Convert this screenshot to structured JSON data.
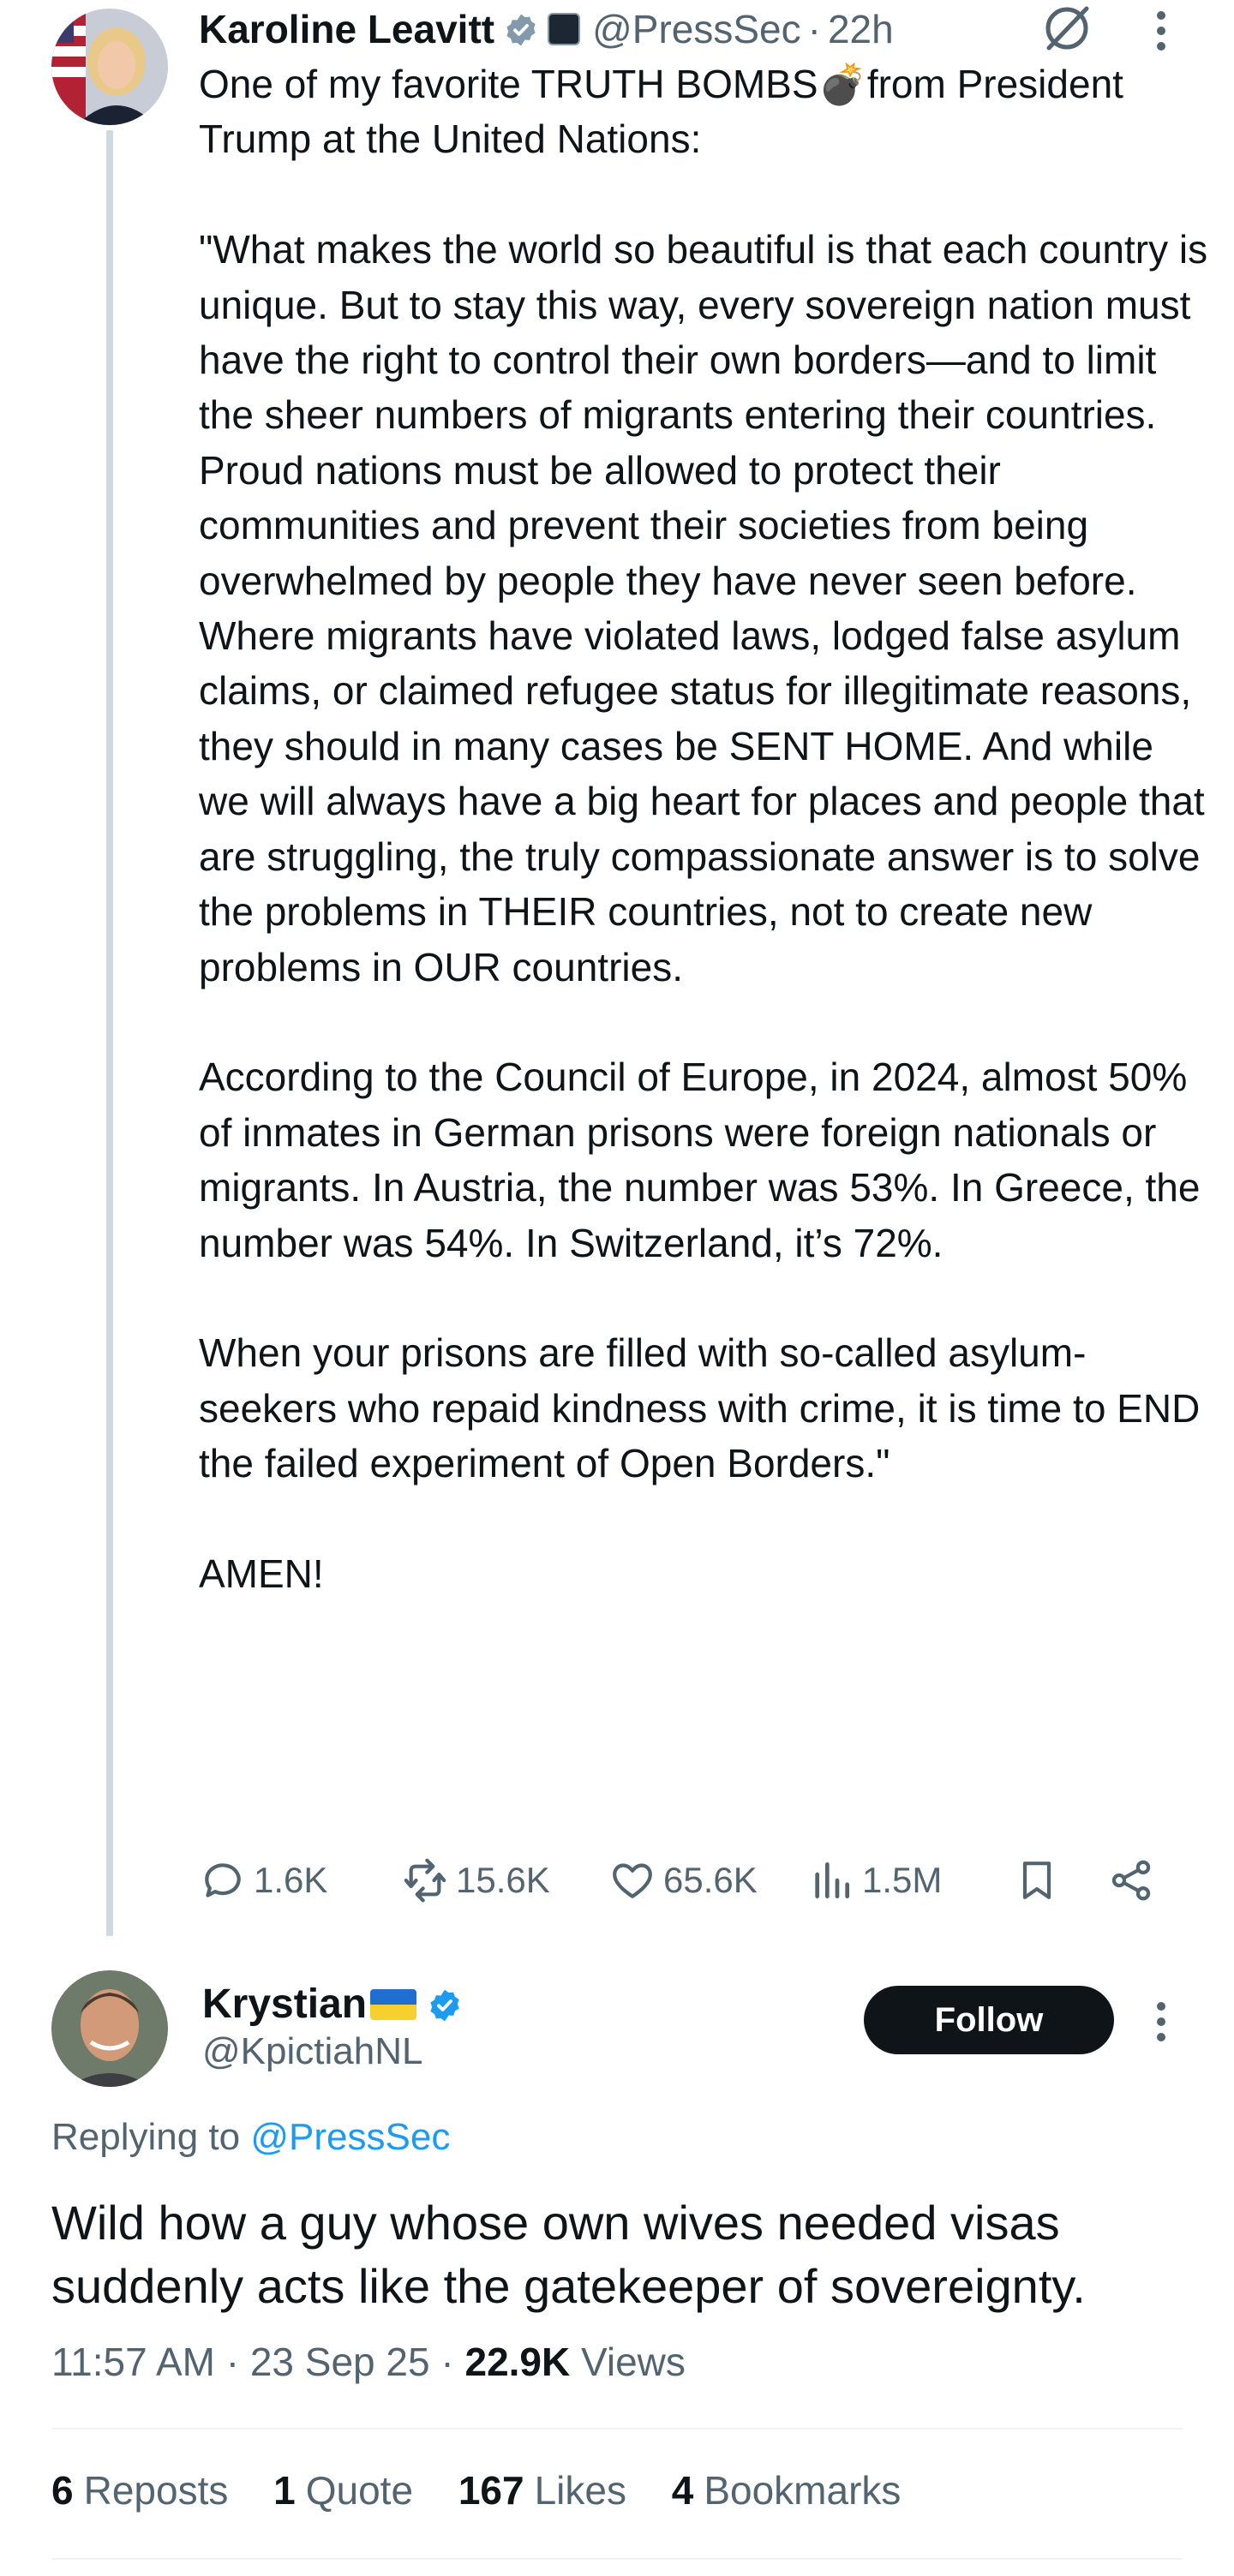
{
  "post": {
    "author_name": "Karoline Leavitt",
    "handle": "@PressSec",
    "separator": "·",
    "time": "22h",
    "text": "One of my favorite TRUTH BOMBS💣from President Trump at the United Nations:\n\n\"What makes the world so beautiful is that each country is unique. But to stay this way, every sovereign nation must have the right to control their own borders—and to limit the sheer numbers of migrants entering their countries. Proud nations must be allowed to protect their communities and prevent their societies from being overwhelmed by people they have never seen before. Where migrants have violated laws, lodged false asylum claims, or claimed refugee status for illegitimate reasons, they should in many cases be SENT HOME. And while we will always have a big heart for places and people that are struggling, the truly compassionate answer is to solve the problems in THEIR countries, not to create new problems in OUR countries.\n\nAccording to the Council of Europe, in 2024, almost 50% of inmates in German prisons were foreign nationals or migrants. In Austria, the number was 53%. In Greece, the number was 54%. In Switzerland, it’s 72%.\n\nWhen your prisons are filled with so-called asylum-seekers who repaid kindness with crime, it is time to END the failed experiment of Open Borders.\"\n\nAMEN!",
    "replies": "1.6K",
    "reposts": "15.6K",
    "likes": "65.6K",
    "views": "1.5M"
  },
  "reply": {
    "author_name": "Krystian",
    "handle": "@KpictiahNL",
    "follow_label": "Follow",
    "replying_prefix": "Replying to",
    "replying_mention": "@PressSec",
    "text": "Wild how a guy whose own wives needed visas suddenly acts like the gatekeeper of sovereignty.",
    "time": "11:57 AM",
    "date": "23 Sep 25",
    "separator": "·",
    "views_count": "22.9K",
    "views_label": "Views",
    "stats": [
      {
        "count": "6",
        "label": "Reposts"
      },
      {
        "count": "1",
        "label": "Quote"
      },
      {
        "count": "167",
        "label": "Likes"
      },
      {
        "count": "4",
        "label": "Bookmarks"
      }
    ]
  },
  "colors": {
    "text_primary": "#0f1419",
    "text_secondary": "#536471",
    "link": "#1d9bf0",
    "verified": "#1d9bf0",
    "thread_line": "#cfd9de",
    "follow_button_bg": "#0f1419"
  },
  "icons": [
    "verified-icon",
    "affiliate-badge-icon",
    "grok-icon",
    "more-icon",
    "reply-icon",
    "repost-icon",
    "like-icon",
    "views-icon",
    "bookmark-icon",
    "share-icon",
    "flag-ukraine-icon"
  ]
}
